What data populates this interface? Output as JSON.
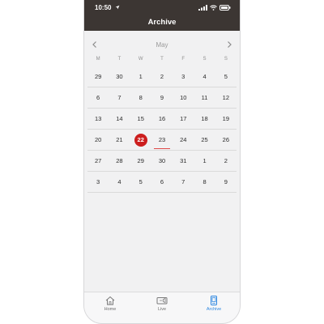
{
  "status": {
    "time": "10:50"
  },
  "header": {
    "title": "Archive"
  },
  "calendar": {
    "month": "May",
    "weekdays": [
      "M",
      "T",
      "W",
      "T",
      "F",
      "S",
      "S"
    ],
    "weeks": [
      [
        "29",
        "30",
        "1",
        "2",
        "3",
        "4",
        "5"
      ],
      [
        "6",
        "7",
        "8",
        "9",
        "10",
        "11",
        "12"
      ],
      [
        "13",
        "14",
        "15",
        "16",
        "17",
        "18",
        "19"
      ],
      [
        "20",
        "21",
        "22",
        "23",
        "24",
        "25",
        "26"
      ],
      [
        "27",
        "28",
        "29",
        "30",
        "31",
        "1",
        "2"
      ],
      [
        "3",
        "4",
        "5",
        "6",
        "7",
        "8",
        "9"
      ]
    ],
    "selected_day": "22",
    "marked_day": "23"
  },
  "tabs": [
    {
      "label": "Home",
      "icon": "home-icon",
      "active": false
    },
    {
      "label": "Live",
      "icon": "camera-icon",
      "active": false
    },
    {
      "label": "Archive",
      "icon": "archive-icon",
      "active": true
    }
  ],
  "colors": {
    "header_bg": "#3c3633",
    "selected": "#cc1e1e",
    "active_tab": "#2d87e0"
  }
}
